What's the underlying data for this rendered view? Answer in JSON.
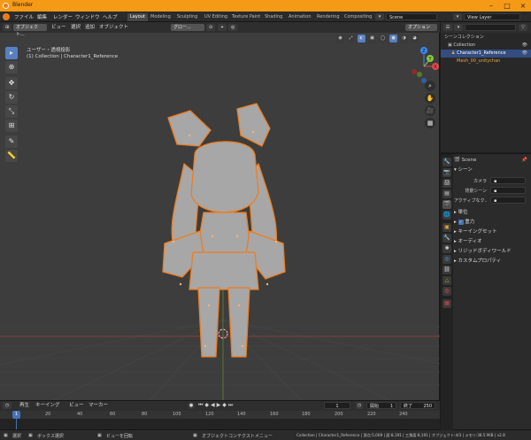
{
  "window": {
    "title": "Blender"
  },
  "menubar": {
    "menus": [
      "ファイル",
      "編集",
      "レンダー",
      "ウィンドウ",
      "ヘルプ"
    ],
    "workspaces": [
      "Layout",
      "Modeling",
      "Sculpting",
      "UV Editing",
      "Texture Paint",
      "Shading",
      "Animation",
      "Rendering",
      "Compositing"
    ],
    "active_workspace": "Layout",
    "scene": "Scene",
    "view_layer": "View Layer"
  },
  "viewport": {
    "mode": "オブジェクト...",
    "menus": [
      "ビュー",
      "選択",
      "追加",
      "オブジェクト"
    ],
    "transform_orientation": "グロー...",
    "options": "オプション",
    "overlay_line1": "ユーザー・透視投影",
    "overlay_line2": "(1) Collection | Character1_Reference",
    "gizmo_axes": {
      "x": "X",
      "y": "Y",
      "z": "Z"
    }
  },
  "timeline": {
    "menus": [
      "再生",
      "キーイング",
      "ビュー",
      "マーカー"
    ],
    "current_frame": "1",
    "start_label": "開始",
    "start": "1",
    "end_label": "終了",
    "end": "250",
    "ruler": [
      "20",
      "40",
      "60",
      "80",
      "100",
      "120",
      "140",
      "160",
      "180",
      "200",
      "220",
      "240"
    ],
    "playhead": "1"
  },
  "statusbar": {
    "select": "選択",
    "box_select": "ボックス選択",
    "rotate_view": "ビューを回転",
    "context_menu": "オブジェクトコンテクストメニュー",
    "stats": "Collection | Character1_Reference | 頂点:5,009 | 面:8,191 | 三角面:8,191 | オブジェクト:4/3 | メモリ:38.5 MiB | v2.8"
  },
  "outliner": {
    "root": "シーンコレクション",
    "items": [
      {
        "label": "Collection",
        "depth": 1
      },
      {
        "label": "Character1_Reference",
        "depth": 2
      },
      {
        "label": "Mesh_00_unitychan",
        "depth": 3
      }
    ]
  },
  "properties": {
    "context": "Scene",
    "section_scene": "シーン",
    "camera_label": "カメラ",
    "bg_scene_label": "背景シーン",
    "active_clip_label": "アクティブなク...",
    "subsections": [
      "単位",
      "重力",
      "キーイングセット",
      "オーディオ",
      "リジッドボディワールド",
      "カスタムプロパティ"
    ],
    "gravity_checked": true
  },
  "colors": {
    "titlebar": "#f49a16",
    "selection_outline": "#f07d1e",
    "active_tool": "#5680c2",
    "x_axis": "#e2484c",
    "y_axis": "#8bc53b",
    "z_axis": "#3d8af7"
  }
}
